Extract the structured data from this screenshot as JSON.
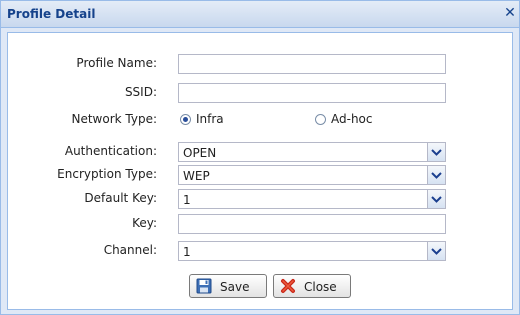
{
  "window": {
    "title": "Profile Detail",
    "close_glyph": "✕"
  },
  "form": {
    "profile_name": {
      "label": "Profile Name:",
      "value": ""
    },
    "ssid": {
      "label": "SSID:",
      "value": ""
    },
    "network_type": {
      "label": "Network Type:",
      "options": [
        "Infra",
        "Ad-hoc"
      ],
      "selected": "Infra"
    },
    "authentication": {
      "label": "Authentication:",
      "value": "OPEN"
    },
    "encryption_type": {
      "label": "Encryption Type:",
      "value": "WEP"
    },
    "default_key": {
      "label": "Default Key:",
      "value": "1"
    },
    "key": {
      "label": "Key:",
      "value": ""
    },
    "channel": {
      "label": "Channel:",
      "value": "1"
    }
  },
  "buttons": {
    "save": "Save",
    "close": "Close"
  },
  "icons": {
    "save": "floppy-disk-icon",
    "close": "red-x-icon",
    "dropdown": "chevron-down-icon"
  },
  "colors": {
    "title_text": "#15428b",
    "frame_border": "#99bbe8",
    "frame_bg": "#dfe8f6",
    "arrow": "#1b3f8f"
  }
}
